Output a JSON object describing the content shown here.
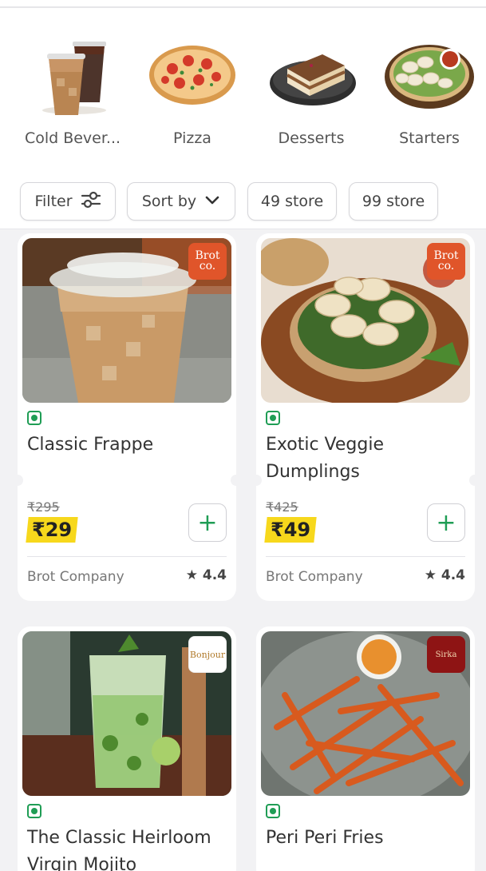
{
  "categories": [
    {
      "label": "Cold Bever...",
      "icon": "cold-beverage-image"
    },
    {
      "label": "Pizza",
      "icon": "pizza-image"
    },
    {
      "label": "Desserts",
      "icon": "dessert-image"
    },
    {
      "label": "Starters",
      "icon": "starters-image"
    }
  ],
  "filters": {
    "filter_label": "Filter",
    "sort_label": "Sort by",
    "chip1": "49 store",
    "chip2": "99 store"
  },
  "products": [
    {
      "veg": true,
      "title": "Classic Frappe",
      "mrp": "₹295",
      "price": "₹29",
      "store": "Brot Company",
      "rating": "4.4",
      "brand": "Brot co."
    },
    {
      "veg": true,
      "title": "Exotic Veggie Dumplings",
      "mrp": "₹425",
      "price": "₹49",
      "store": "Brot Company",
      "rating": "4.4",
      "brand": "Brot co."
    },
    {
      "veg": true,
      "title": "The Classic Heirloom Virgin Mojito",
      "brand": "Bonjour"
    },
    {
      "veg": true,
      "title": "Peri Peri Fries",
      "brand": "Sirka"
    }
  ],
  "colors": {
    "accent_green": "#1f9d55",
    "price_yellow": "#f7d81c",
    "brot_orange": "#e0552a",
    "sirka_red": "#8e1414"
  }
}
